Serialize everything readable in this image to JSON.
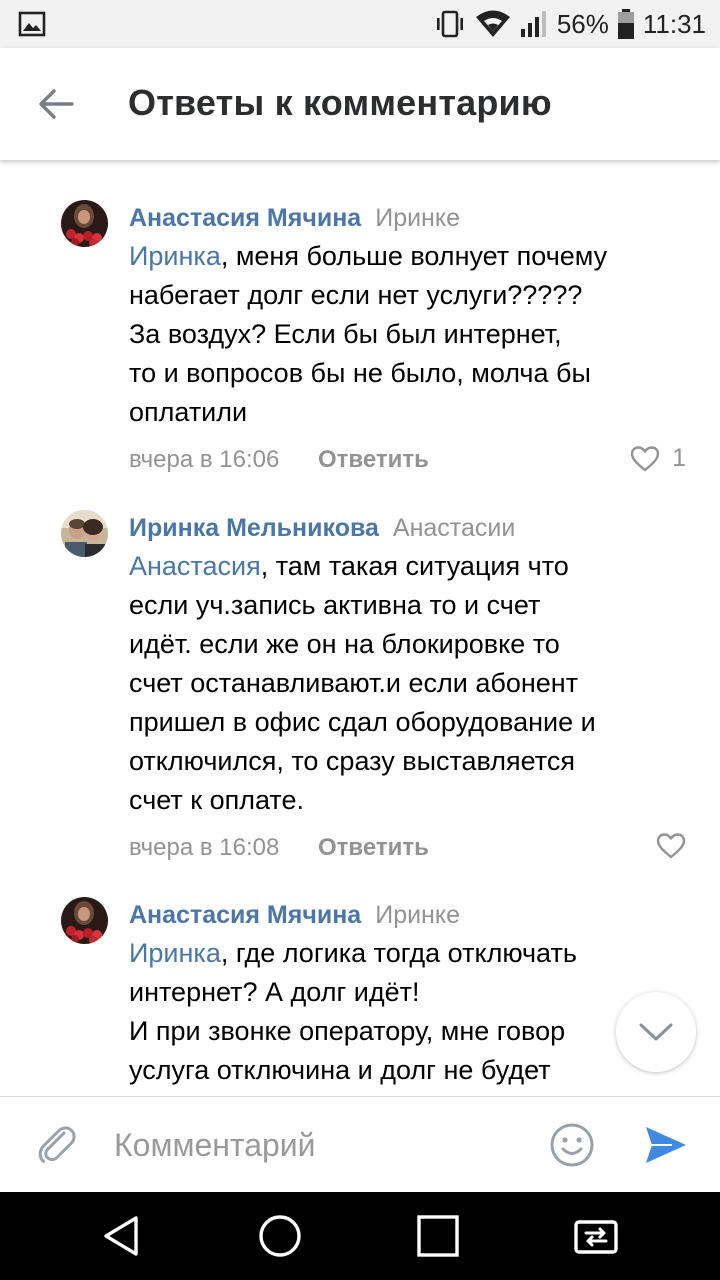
{
  "status_bar": {
    "battery": "56%",
    "time": "11:31",
    "icons": [
      "gallery-icon",
      "vibrate-icon",
      "wifi-icon",
      "signal-icon",
      "battery-icon"
    ]
  },
  "header": {
    "title": "Ответы к комментарию",
    "back_icon": "arrow-left-icon"
  },
  "comments": [
    {
      "author": "Анастасия Мячина",
      "reply_to": "Иринке",
      "mention": "Иринка",
      "text": ", меня больше волнует почему\nнабегает долг если нет услуги?????\nЗа воздух? Если бы был интернет,\nто и вопросов бы не было, молча бы\nоплатили",
      "time": "вчера в 16:06",
      "reply_label": "Ответить",
      "likes": "1"
    },
    {
      "author": "Иринка Мельникова",
      "reply_to": "Анастасии",
      "mention": "Анастасия",
      "text": ", там такая ситуация что\nесли уч.запись активна то и счет\nидёт. если же он на блокировке то\nсчет останавливают.и если абонент\nпришел в офис сдал оборудование и\nотключился, то сразу выставляется\nсчет к оплате.",
      "time": "вчера в 16:08",
      "reply_label": "Ответить",
      "likes": ""
    },
    {
      "author": "Анастасия Мячина",
      "reply_to": "Иринке",
      "mention": "Иринка",
      "text": ", где логика тогда отключать\nинтернет? А долг идёт!\nИ при звонке оператору, мне говор\nуслуга отключина и долг не будет",
      "time": "",
      "reply_label": "",
      "likes": ""
    }
  ],
  "composer": {
    "placeholder": "Комментарий",
    "value": ""
  },
  "colors": {
    "accent": "#4a76a8",
    "secondary_text": "#939393",
    "send": "#3f8ae0"
  }
}
